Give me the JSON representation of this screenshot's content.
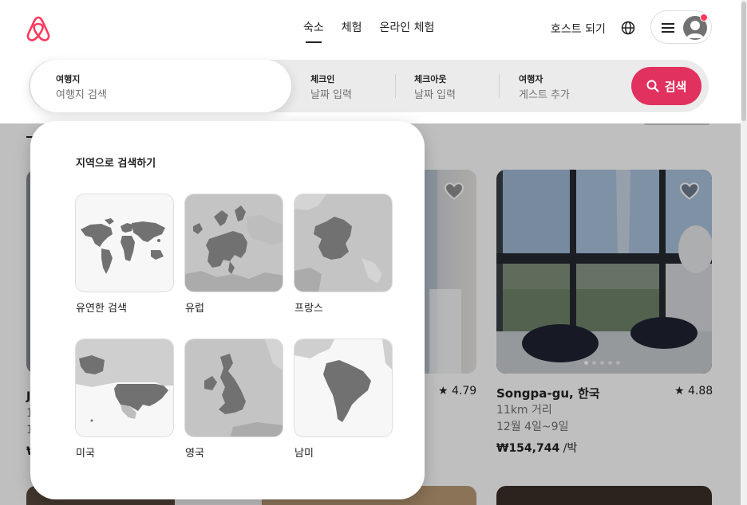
{
  "header": {
    "tabs": [
      {
        "label": "숙소",
        "active": true
      },
      {
        "label": "체험",
        "active": false
      },
      {
        "label": "온라인 체험",
        "active": false
      }
    ],
    "host_label": "호스트 되기",
    "icons": {
      "logo": "airbnb-logo-icon",
      "globe": "globe-icon",
      "menu": "hamburger-icon",
      "avatar": "user-avatar-icon"
    }
  },
  "search": {
    "destination": {
      "label": "여행지",
      "placeholder": "여행지 검색"
    },
    "checkin": {
      "label": "체크인",
      "placeholder": "날짜 입력"
    },
    "checkout": {
      "label": "체크아웃",
      "placeholder": "날짜 입력"
    },
    "guests": {
      "label": "여행자",
      "placeholder": "게스트 추가"
    },
    "button_label": "검색"
  },
  "region_panel": {
    "title": "지역으로 검색하기",
    "regions": [
      {
        "name": "유연한 검색",
        "map": "world-map"
      },
      {
        "name": "유럽",
        "map": "europe-map"
      },
      {
        "name": "프랑스",
        "map": "france-map"
      },
      {
        "name": "미국",
        "map": "usa-map"
      },
      {
        "name": "영국",
        "map": "uk-map"
      },
      {
        "name": "남미",
        "map": "south-america-map"
      }
    ]
  },
  "listings": [
    {
      "title": "Songpa-gu, 한국",
      "rating": "★ 4.88",
      "distance": "11km 거리",
      "dates": "12월 4일~9일",
      "price": "₩154,744",
      "price_unit": " /박"
    },
    {
      "rating": "★ 4.79"
    }
  ],
  "colors": {
    "brand": "#ff385c",
    "search_button": "#e1325f",
    "text": "#222222",
    "muted": "#717171"
  }
}
